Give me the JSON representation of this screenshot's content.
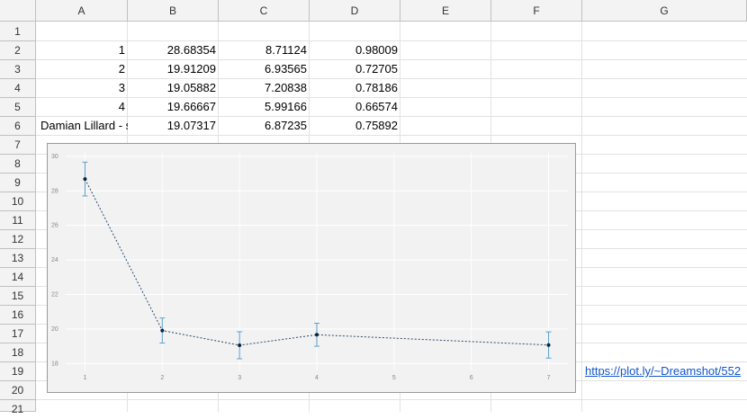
{
  "columns": [
    "A",
    "B",
    "C",
    "D",
    "E",
    "F",
    "G"
  ],
  "rows": [
    "1",
    "2",
    "3",
    "4",
    "5",
    "6",
    "7",
    "8",
    "9",
    "10",
    "11",
    "12",
    "13",
    "14",
    "15",
    "16",
    "17",
    "18",
    "19",
    "20",
    "21"
  ],
  "cells": {
    "r2": [
      "1",
      "28.68354",
      "8.71124",
      "0.98009"
    ],
    "r3": [
      "2",
      "19.91209",
      "6.93565",
      "0.72705"
    ],
    "r4": [
      "3",
      "19.05882",
      "7.20838",
      "0.78186"
    ],
    "r5": [
      "4",
      "19.66667",
      "5.99166",
      "0.66574"
    ],
    "r6": [
      "Damian Lillard - s",
      "19.07317",
      "6.87235",
      "0.75892"
    ]
  },
  "link_text": "https://plot.ly/~Dreamshot/552",
  "chart_data": {
    "type": "line",
    "x": [
      1,
      2,
      3,
      4,
      7
    ],
    "y": [
      28.68354,
      19.91209,
      19.05882,
      19.66667,
      19.07317
    ],
    "error": [
      0.98009,
      0.72705,
      0.78186,
      0.66574,
      0.75892
    ],
    "xticks": [
      "1",
      "2",
      "3",
      "4",
      "5",
      "6",
      "7"
    ],
    "yticks": [
      "18",
      "20",
      "22",
      "24",
      "26",
      "28",
      "30"
    ],
    "xlim": [
      0.75,
      7.25
    ],
    "ylim": [
      17.6,
      30.2
    ],
    "grid": true,
    "line_style": "dotted",
    "line_color": "#2a4a6a",
    "errorbar_color": "#5aa0d0",
    "background": "#f2f2f2"
  }
}
